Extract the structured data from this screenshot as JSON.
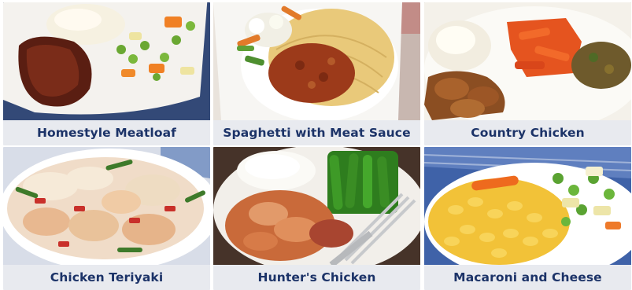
{
  "meals": [
    {
      "name": "Homestyle Meatloaf"
    },
    {
      "name": "Spaghetti with Meat Sauce"
    },
    {
      "name": "Country Chicken"
    },
    {
      "name": "Chicken Teriyaki"
    },
    {
      "name": "Hunter's Chicken"
    },
    {
      "name": "Macaroni and Cheese"
    }
  ],
  "colors": {
    "caption_bg": "#e8eaef",
    "caption_text": "#1c3368"
  }
}
